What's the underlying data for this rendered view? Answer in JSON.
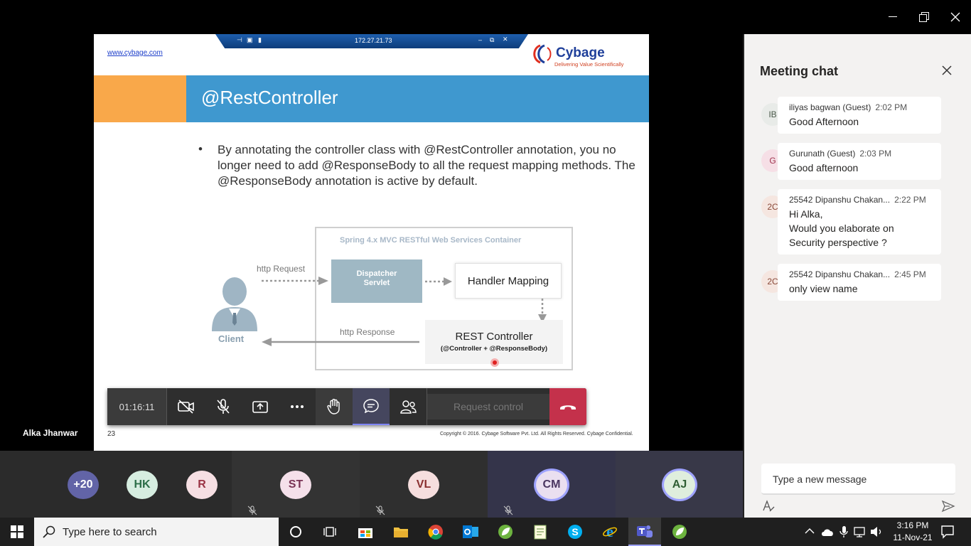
{
  "window": {
    "minimize_icon": "minimize-icon",
    "restore_icon": "restore-icon",
    "close_icon": "close-icon"
  },
  "remote_bar": {
    "address": "172.27.21.73"
  },
  "slide": {
    "url": "www.cybage.com",
    "logo_text": "Cybage",
    "logo_tagline": "Delivering Value Scientifically",
    "title": "@RestController",
    "bullet": "•",
    "bullet_text": "By annotating the controller class with @RestController annotation, you no longer need to add @ResponseBody to all the request mapping methods. The @ResponseBody annotation is active by default.",
    "diagram": {
      "container_title": "Spring 4.x MVC RESTful Web Services Container",
      "http_request": "http Request",
      "http_response": "http Response",
      "dispatcher_line1": "Dispatcher",
      "dispatcher_line2": "Servlet",
      "handler": "Handler Mapping",
      "rest_title": "REST Controller",
      "rest_sub": "(@Controller + @ResponseBody)",
      "client": "Client"
    },
    "number": "23",
    "copyright": "Copyright © 2016. Cybage Software Pvt. Ltd. All Rights Reserved. Cybage Confidential."
  },
  "presenter_name": "Alka Jhanwar",
  "toolbar": {
    "timer": "01:16:11",
    "request_control": "Request control"
  },
  "chat": {
    "title": "Meeting chat",
    "messages": [
      {
        "initials": "IB",
        "name": "iliyas bagwan (Guest)",
        "time": "2:02 PM",
        "text": "Good Afternoon",
        "avatar_bg": "#e8ebe8",
        "avatar_fg": "#4a5a4a"
      },
      {
        "initials": "G",
        "name": "Gurunath (Guest)",
        "time": "2:03 PM",
        "text": "Good afternoon",
        "avatar_bg": "#f6dfe6",
        "avatar_fg": "#a0344f"
      },
      {
        "initials": "2C",
        "name": "25542 Dipanshu Chakan...",
        "time": "2:22 PM",
        "text1": "Hi Alka,",
        "text2": "Would you elaborate on",
        "text3": "Security perspective ?",
        "avatar_bg": "#f5e6e0",
        "avatar_fg": "#8a4a3a"
      },
      {
        "initials": "2C",
        "name": "25542 Dipanshu Chakan...",
        "time": "2:45 PM",
        "text": "only view name",
        "avatar_bg": "#f5e6e0",
        "avatar_fg": "#8a4a3a"
      }
    ],
    "compose_placeholder": "Type a new message"
  },
  "participants": [
    {
      "initials": "+20",
      "bg": "#6264a7",
      "fg": "#ffffff"
    },
    {
      "initials": "HK",
      "bg": "#d6ede0",
      "fg": "#2c6e49"
    },
    {
      "initials": "R",
      "bg": "#f6dfe3",
      "fg": "#9a3344"
    },
    {
      "initials": "ST",
      "bg": "#f5e0ea",
      "fg": "#7a3355"
    },
    {
      "initials": "VL",
      "bg": "#f6dede",
      "fg": "#8a3030"
    },
    {
      "initials": "CM",
      "bg": "#eadff0",
      "fg": "#4a3560"
    },
    {
      "initials": "AJ",
      "bg": "#dfeedd",
      "fg": "#2f5e33"
    }
  ],
  "taskbar": {
    "search_placeholder": "Type here to search",
    "time": "3:16 PM",
    "date": "11-Nov-21"
  }
}
